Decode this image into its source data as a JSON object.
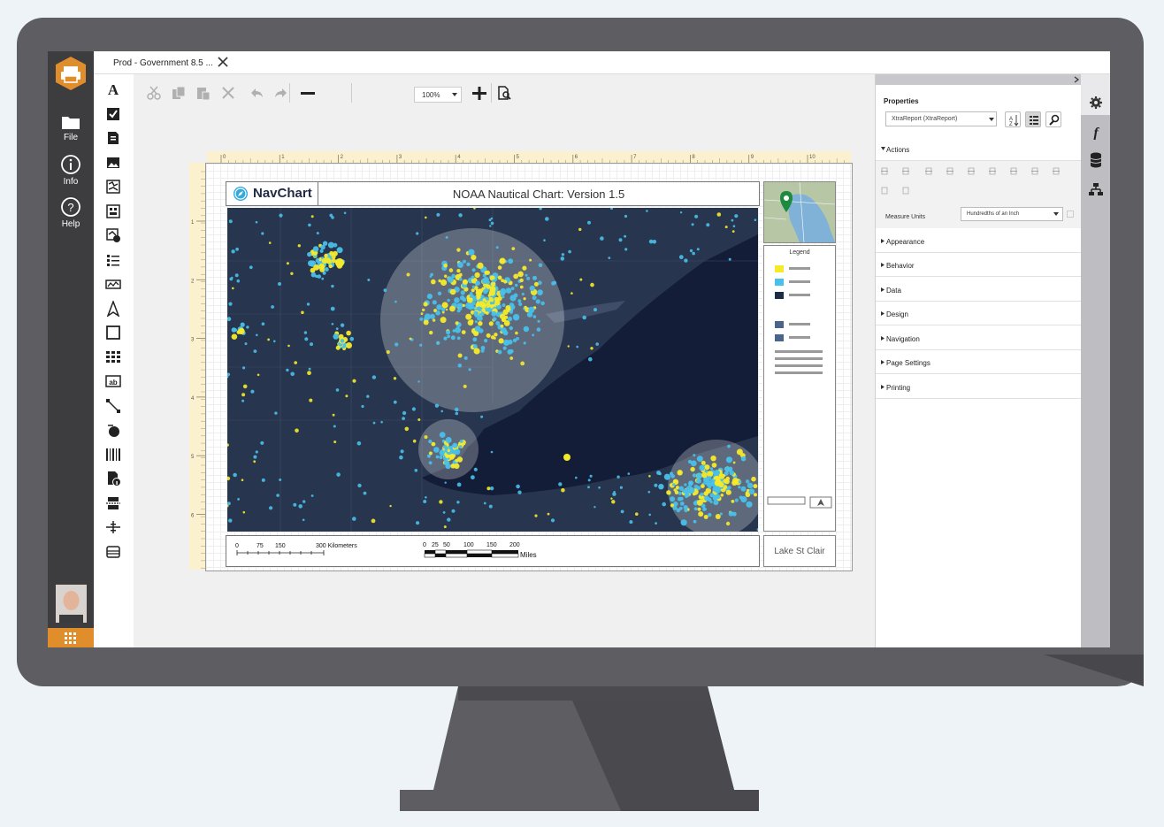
{
  "tab": {
    "label": "Prod - Government 8.5 ..."
  },
  "nav": {
    "file_label": "File",
    "info_label": "Info",
    "help_label": "Help"
  },
  "toolbar": {
    "zoom_value": "100%"
  },
  "report": {
    "brand": "NavChart",
    "title": "NOAA Nautical Chart: Version 1.5",
    "legend_title": "Legend",
    "lake_label": "Lake St Clair",
    "scale_km": {
      "ticks": [
        "0",
        "75",
        "150",
        "300 Kilometers"
      ]
    },
    "scale_mi": {
      "ticks": [
        "0",
        "25",
        "50",
        "100",
        "150",
        "200"
      ],
      "unit": "Miles"
    },
    "ruler_top": [
      "0",
      "1",
      "2",
      "3",
      "4",
      "5",
      "6",
      "7",
      "8",
      "9",
      "10"
    ],
    "ruler_left": [
      "1",
      "2",
      "3",
      "4",
      "5",
      "6"
    ]
  },
  "properties": {
    "title": "Properties",
    "selected_object": "XtraReport (XtraReport)",
    "sections": [
      {
        "label": "Actions",
        "expanded": true
      },
      {
        "label": "Appearance"
      },
      {
        "label": "Behavior"
      },
      {
        "label": "Data"
      },
      {
        "label": "Design"
      },
      {
        "label": "Navigation"
      },
      {
        "label": "Page Settings"
      },
      {
        "label": "Printing"
      }
    ],
    "measure_units_label": "Measure Units",
    "measure_units_value": "Hundredths of an Inch"
  },
  "colors": {
    "accent_orange": "#e08e2b",
    "dot_yellow": "#f5ea2a",
    "dot_blue": "#48c0ea",
    "map_bg": "#28354f",
    "lake": "#141d38"
  }
}
